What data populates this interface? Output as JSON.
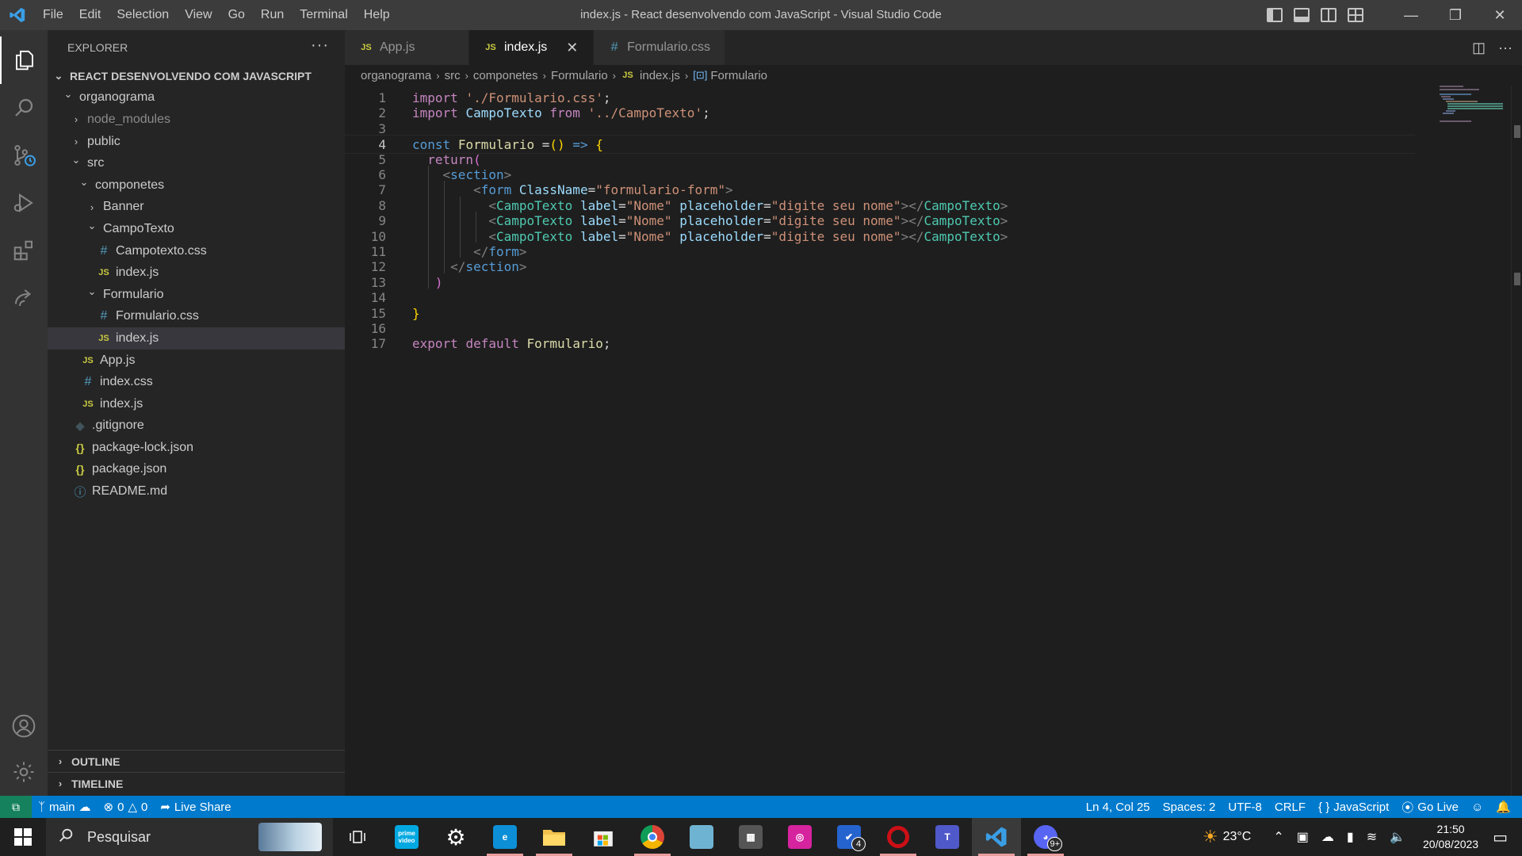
{
  "window": {
    "title": "index.js - React desenvolvendo com JavaScript - Visual Studio Code"
  },
  "menu": [
    "File",
    "Edit",
    "Selection",
    "View",
    "Go",
    "Run",
    "Terminal",
    "Help"
  ],
  "activitybar": {
    "items": [
      "explorer-icon",
      "search-icon",
      "source-control-icon",
      "run-debug-icon",
      "extensions-icon",
      "live-share-icon"
    ],
    "bottom": [
      "accounts-icon",
      "manage-gear-icon"
    ]
  },
  "sidebar": {
    "title": "EXPLORER",
    "more": "···",
    "project": "REACT DESENVOLVENDO COM JAVASCRIPT",
    "tree": [
      {
        "label": "organograma",
        "kind": "folder-open",
        "depth": 0
      },
      {
        "label": "node_modules",
        "kind": "folder",
        "depth": 1,
        "dim": true
      },
      {
        "label": "public",
        "kind": "folder",
        "depth": 1
      },
      {
        "label": "src",
        "kind": "folder-open",
        "depth": 1
      },
      {
        "label": "componetes",
        "kind": "folder-open",
        "depth": 2
      },
      {
        "label": "Banner",
        "kind": "folder",
        "depth": 3
      },
      {
        "label": "CampoTexto",
        "kind": "folder-open",
        "depth": 3
      },
      {
        "label": "Campotexto.css",
        "kind": "css",
        "depth": 4
      },
      {
        "label": "index.js",
        "kind": "js",
        "depth": 4
      },
      {
        "label": "Formulario",
        "kind": "folder-open",
        "depth": 3
      },
      {
        "label": "Formulario.css",
        "kind": "css",
        "depth": 4
      },
      {
        "label": "index.js",
        "kind": "js",
        "depth": 4,
        "selected": true
      },
      {
        "label": "App.js",
        "kind": "js",
        "depth": 2
      },
      {
        "label": "index.css",
        "kind": "css",
        "depth": 2
      },
      {
        "label": "index.js",
        "kind": "js",
        "depth": 2
      },
      {
        "label": ".gitignore",
        "kind": "git",
        "depth": 1
      },
      {
        "label": "package-lock.json",
        "kind": "json",
        "depth": 1
      },
      {
        "label": "package.json",
        "kind": "json",
        "depth": 1
      },
      {
        "label": "README.md",
        "kind": "info",
        "depth": 1
      }
    ],
    "outline": "OUTLINE",
    "timeline": "TIMELINE"
  },
  "icons": {
    "js": "JS",
    "css": "#",
    "json": "{}",
    "git": "◆",
    "info": "ⓘ"
  },
  "tabs": [
    {
      "label": "App.js",
      "kind": "js",
      "active": false
    },
    {
      "label": "index.js",
      "kind": "js",
      "active": true,
      "close": "✕"
    },
    {
      "label": "Formulario.css",
      "kind": "css",
      "active": false
    }
  ],
  "breadcrumb": [
    "organograma",
    "src",
    "componetes",
    "Formulario",
    "index.js",
    "Formulario"
  ],
  "editor": {
    "current_line": 4,
    "lines": [
      [
        [
          "kw",
          "import"
        ],
        [
          "p",
          " "
        ],
        [
          "str",
          "'./Formulario.css'"
        ],
        [
          "p",
          ";"
        ]
      ],
      [
        [
          "kw",
          "import"
        ],
        [
          "p",
          " "
        ],
        [
          "var",
          "CampoTexto"
        ],
        [
          "p",
          " "
        ],
        [
          "kw",
          "from"
        ],
        [
          "p",
          " "
        ],
        [
          "str",
          "'../CampoTexto'"
        ],
        [
          "p",
          ";"
        ]
      ],
      [],
      [
        [
          "kw2",
          "const"
        ],
        [
          "p",
          " "
        ],
        [
          "fn",
          "Formulario"
        ],
        [
          "p",
          " ="
        ],
        [
          "brace",
          "()"
        ],
        [
          "p",
          " "
        ],
        [
          "kw2",
          "=>"
        ],
        [
          "p",
          " "
        ],
        [
          "brace",
          "{"
        ]
      ],
      [
        [
          "p",
          "  "
        ],
        [
          "kw",
          "return"
        ],
        [
          "paren",
          "("
        ]
      ],
      [
        [
          "p",
          "    "
        ],
        [
          "tag",
          "<"
        ],
        [
          "tagn",
          "section"
        ],
        [
          "tag",
          ">"
        ]
      ],
      [
        [
          "p",
          "        "
        ],
        [
          "tag",
          "<"
        ],
        [
          "tagn",
          "form"
        ],
        [
          "p",
          " "
        ],
        [
          "var",
          "ClassName"
        ],
        [
          "p",
          "="
        ],
        [
          "str",
          "\"formulario-form\""
        ],
        [
          "tag",
          ">"
        ]
      ],
      [
        [
          "p",
          "          "
        ],
        [
          "tag",
          "<"
        ],
        [
          "cls",
          "CampoTexto"
        ],
        [
          "p",
          " "
        ],
        [
          "var",
          "label"
        ],
        [
          "p",
          "="
        ],
        [
          "str",
          "\"Nome\""
        ],
        [
          "p",
          " "
        ],
        [
          "var",
          "placeholder"
        ],
        [
          "p",
          "="
        ],
        [
          "str",
          "\"digite seu nome\""
        ],
        [
          "tag",
          "></"
        ],
        [
          "cls",
          "CampoTexto"
        ],
        [
          "tag",
          ">"
        ]
      ],
      [
        [
          "p",
          "          "
        ],
        [
          "tag",
          "<"
        ],
        [
          "cls",
          "CampoTexto"
        ],
        [
          "p",
          " "
        ],
        [
          "var",
          "label"
        ],
        [
          "p",
          "="
        ],
        [
          "str",
          "\"Nome\""
        ],
        [
          "p",
          " "
        ],
        [
          "var",
          "placeholder"
        ],
        [
          "p",
          "="
        ],
        [
          "str",
          "\"digite seu nome\""
        ],
        [
          "tag",
          "></"
        ],
        [
          "cls",
          "CampoTexto"
        ],
        [
          "tag",
          ">"
        ]
      ],
      [
        [
          "p",
          "          "
        ],
        [
          "tag",
          "<"
        ],
        [
          "cls",
          "CampoTexto"
        ],
        [
          "p",
          " "
        ],
        [
          "var",
          "label"
        ],
        [
          "p",
          "="
        ],
        [
          "str",
          "\"Nome\""
        ],
        [
          "p",
          " "
        ],
        [
          "var",
          "placeholder"
        ],
        [
          "p",
          "="
        ],
        [
          "str",
          "\"digite seu nome\""
        ],
        [
          "tag",
          "></"
        ],
        [
          "cls",
          "CampoTexto"
        ],
        [
          "tag",
          ">"
        ]
      ],
      [
        [
          "p",
          "        "
        ],
        [
          "tag",
          "</"
        ],
        [
          "tagn",
          "form"
        ],
        [
          "tag",
          ">"
        ]
      ],
      [
        [
          "p",
          "     "
        ],
        [
          "tag",
          "</"
        ],
        [
          "tagn",
          "section"
        ],
        [
          "tag",
          ">"
        ]
      ],
      [
        [
          "p",
          "   "
        ],
        [
          "paren",
          ")"
        ]
      ],
      [],
      [
        [
          "brace",
          "}"
        ]
      ],
      [],
      [
        [
          "kw",
          "export"
        ],
        [
          "p",
          " "
        ],
        [
          "kw",
          "default"
        ],
        [
          "p",
          " "
        ],
        [
          "fn",
          "Formulario"
        ],
        [
          "p",
          ";"
        ]
      ]
    ]
  },
  "statusbar": {
    "branch": "main",
    "errors": "0",
    "warnings": "0",
    "live_share": "Live Share",
    "position": "Ln 4, Col 25",
    "spaces": "Spaces: 2",
    "encoding": "UTF-8",
    "eol": "CRLF",
    "language": "JavaScript",
    "go_live": "Go Live"
  },
  "taskbar": {
    "search_placeholder": "Pesquisar",
    "apps": [
      {
        "name": "task-view",
        "label": ""
      },
      {
        "name": "prime-video",
        "label": "prime video",
        "color": "#00a8e1"
      },
      {
        "name": "settings",
        "label": "⚙",
        "color": "transparent"
      },
      {
        "name": "edge",
        "label": "e",
        "color": "#0c8fd6"
      },
      {
        "name": "file-explorer",
        "label": "",
        "color": "#f2c14e"
      },
      {
        "name": "microsoft-store",
        "label": "",
        "color": "#f0f0f0"
      },
      {
        "name": "chrome",
        "label": "",
        "color": "#db4437"
      },
      {
        "name": "app-blue",
        "label": "",
        "color": "#6fb3d2"
      },
      {
        "name": "calculator",
        "label": "▦",
        "color": "#555555"
      },
      {
        "name": "instagram",
        "label": "◎",
        "color": "#d6249f"
      },
      {
        "name": "todo",
        "label": "✔",
        "color": "#2564cf",
        "badge": "4"
      },
      {
        "name": "opera",
        "label": "O",
        "color": "#cc0f16"
      },
      {
        "name": "teams",
        "label": "T",
        "color": "#5059c9"
      },
      {
        "name": "vscode",
        "label": "",
        "color": "#0078d4"
      },
      {
        "name": "discord",
        "label": "",
        "color": "#5865f2",
        "badge": "9+"
      }
    ],
    "weather": "23°C",
    "time": "21:50",
    "date": "20/08/2023"
  }
}
